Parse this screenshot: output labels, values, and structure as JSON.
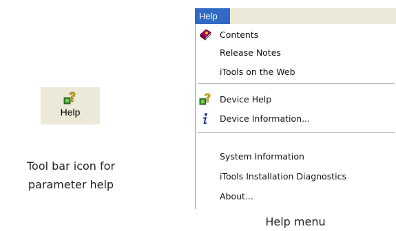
{
  "toolbar": {
    "help_label": "Help",
    "caption": "Tool bar icon for parameter help",
    "icon": "help-question-icon"
  },
  "menu": {
    "title": "Help",
    "caption": "Help menu",
    "accent": "#316ac5",
    "items": [
      {
        "label": "Contents",
        "icon": "help-book-icon"
      },
      {
        "label": "Release Notes"
      },
      {
        "label": "iTools on the Web"
      },
      {
        "label": "Device Help",
        "icon": "help-question-icon"
      },
      {
        "label": "Device Information...",
        "icon": "info-icon"
      },
      {
        "label": "System Information"
      },
      {
        "label": "iTools Installation Diagnostics"
      },
      {
        "label": "About..."
      }
    ]
  }
}
